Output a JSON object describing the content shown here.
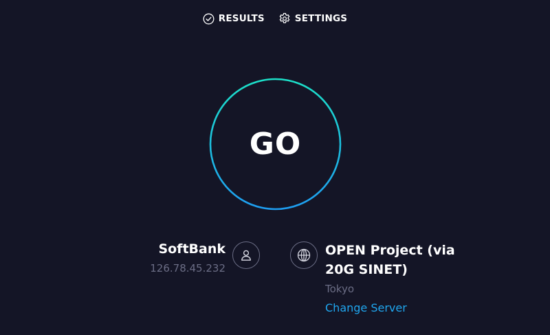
{
  "nav": {
    "results_label": "RESULTS",
    "settings_label": "SETTINGS"
  },
  "go_button": {
    "label": "GO"
  },
  "isp": {
    "name": "SoftBank",
    "ip": "126.78.45.232"
  },
  "server": {
    "name": "OPEN Project (via 20G SINET)",
    "location": "Tokyo",
    "change_label": "Change Server"
  },
  "icons": {
    "results": "check-circle-icon",
    "settings": "gear-icon",
    "isp": "user-icon",
    "server": "globe-icon"
  },
  "colors": {
    "background": "#141526",
    "ring_start": "#1ce0c8",
    "ring_end": "#1e9ef2",
    "muted_text": "#6b6d85",
    "link": "#1fa7f0"
  }
}
